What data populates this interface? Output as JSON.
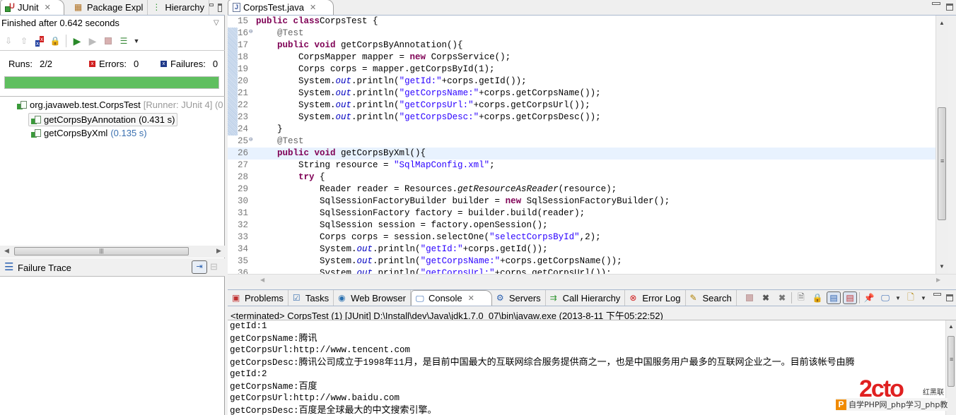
{
  "left_panel": {
    "tabs": [
      {
        "label": "JUnit",
        "active": true,
        "icon": "junit-icon"
      },
      {
        "label": "Package Expl",
        "active": false,
        "icon": "package-explorer-icon"
      },
      {
        "label": "Hierarchy",
        "active": false,
        "icon": "hierarchy-icon"
      }
    ],
    "status": "Finished after 0.642 seconds",
    "runs_label": "Runs:",
    "runs_value": "2/2",
    "errors_label": "Errors:",
    "errors_value": "0",
    "failures_label": "Failures:",
    "failures_value": "0",
    "progress": 1.0,
    "progress_color": "#5fbf5f",
    "tree": {
      "suite_name": "org.javaweb.test.CorpsTest",
      "suite_meta": "[Runner: JUnit 4] (0",
      "tests": [
        {
          "name": "getCorpsByAnnotation",
          "time": "(0.431 s)",
          "selected": true
        },
        {
          "name": "getCorpsByXml",
          "time": "(0.135 s)",
          "selected": false
        }
      ]
    },
    "failure_trace_label": "Failure Trace"
  },
  "editor": {
    "tab_label": "CorpsTest.java",
    "lines": [
      {
        "n": "15",
        "parts": [
          [
            "kw",
            "public class"
          ],
          [
            "",
            "CorpsTest {"
          ]
        ]
      },
      {
        "n": "16",
        "fold": true,
        "parts": [
          [
            "",
            "    "
          ],
          [
            "ann",
            "@Test"
          ]
        ]
      },
      {
        "n": "17",
        "parts": [
          [
            "",
            "    "
          ],
          [
            "kw",
            "public void"
          ],
          [
            "",
            " getCorpsByAnnotation(){"
          ]
        ]
      },
      {
        "n": "18",
        "parts": [
          [
            "",
            "        CorpsMapper mapper = "
          ],
          [
            "kw",
            "new"
          ],
          [
            "",
            " CorpsService();"
          ]
        ]
      },
      {
        "n": "19",
        "parts": [
          [
            "",
            "        Corps corps = mapper.getCorpsById(1);"
          ]
        ]
      },
      {
        "n": "20",
        "parts": [
          [
            "",
            "        System."
          ],
          [
            "fld",
            "out"
          ],
          [
            "",
            ".println("
          ],
          [
            "str",
            "\"getId:\""
          ],
          [
            "",
            "+corps.getId());"
          ]
        ]
      },
      {
        "n": "21",
        "parts": [
          [
            "",
            "        System."
          ],
          [
            "fld",
            "out"
          ],
          [
            "",
            ".println("
          ],
          [
            "str",
            "\"getCorpsName:\""
          ],
          [
            "",
            "+corps.getCorpsName());"
          ]
        ]
      },
      {
        "n": "22",
        "parts": [
          [
            "",
            "        System."
          ],
          [
            "fld",
            "out"
          ],
          [
            "",
            ".println("
          ],
          [
            "str",
            "\"getCorpsUrl:\""
          ],
          [
            "",
            "+corps.getCorpsUrl());"
          ]
        ]
      },
      {
        "n": "23",
        "parts": [
          [
            "",
            "        System."
          ],
          [
            "fld",
            "out"
          ],
          [
            "",
            ".println("
          ],
          [
            "str",
            "\"getCorpsDesc:\""
          ],
          [
            "",
            "+corps.getCorpsDesc());"
          ]
        ]
      },
      {
        "n": "24",
        "parts": [
          [
            "",
            "    }"
          ]
        ]
      },
      {
        "n": "25",
        "fold": true,
        "parts": [
          [
            "",
            "    "
          ],
          [
            "ann",
            "@Test"
          ]
        ]
      },
      {
        "n": "26",
        "highlight": true,
        "parts": [
          [
            "",
            "    "
          ],
          [
            "kw",
            "public void"
          ],
          [
            "",
            " getCorpsByXml(){"
          ]
        ]
      },
      {
        "n": "27",
        "parts": [
          [
            "",
            "        String resource = "
          ],
          [
            "str",
            "\"SqlMapConfig.xml\""
          ],
          [
            "",
            ";"
          ]
        ]
      },
      {
        "n": "28",
        "parts": [
          [
            "",
            "        "
          ],
          [
            "kw",
            "try"
          ],
          [
            "",
            " {"
          ]
        ]
      },
      {
        "n": "29",
        "parts": [
          [
            "",
            "            Reader reader = Resources."
          ],
          [
            "it",
            "getResourceAsReader"
          ],
          [
            "",
            "(resource);"
          ]
        ]
      },
      {
        "n": "30",
        "parts": [
          [
            "",
            "            SqlSessionFactoryBuilder builder = "
          ],
          [
            "kw",
            "new"
          ],
          [
            "",
            " SqlSessionFactoryBuilder();"
          ]
        ]
      },
      {
        "n": "31",
        "parts": [
          [
            "",
            "            SqlSessionFactory factory = builder.build(reader);"
          ]
        ]
      },
      {
        "n": "32",
        "parts": [
          [
            "",
            "            SqlSession session = factory.openSession();"
          ]
        ]
      },
      {
        "n": "33",
        "parts": [
          [
            "",
            "            Corps corps = session.selectOne("
          ],
          [
            "str",
            "\"selectCorpsById\""
          ],
          [
            "",
            ",2);"
          ]
        ]
      },
      {
        "n": "34",
        "parts": [
          [
            "",
            "            System."
          ],
          [
            "fld",
            "out"
          ],
          [
            "",
            ".println("
          ],
          [
            "str",
            "\"getId:\""
          ],
          [
            "",
            "+corps.getId());"
          ]
        ]
      },
      {
        "n": "35",
        "parts": [
          [
            "",
            "            System."
          ],
          [
            "fld",
            "out"
          ],
          [
            "",
            ".println("
          ],
          [
            "str",
            "\"getCorpsName:\""
          ],
          [
            "",
            "+corps.getCorpsName());"
          ]
        ]
      },
      {
        "n": "36",
        "parts": [
          [
            "",
            "            System."
          ],
          [
            "fld",
            "out"
          ],
          [
            "",
            ".println("
          ],
          [
            "str",
            "\"getCorpsUrl:\""
          ],
          [
            "",
            "+corps.getCorpsUrl());"
          ]
        ]
      }
    ]
  },
  "bottom_panel": {
    "tabs": [
      {
        "label": "Problems",
        "icon": "problems-icon"
      },
      {
        "label": "Tasks",
        "icon": "tasks-icon"
      },
      {
        "label": "Web Browser",
        "icon": "globe-icon"
      },
      {
        "label": "Console",
        "icon": "console-icon",
        "active": true
      },
      {
        "label": "Servers",
        "icon": "servers-icon"
      },
      {
        "label": "Call Hierarchy",
        "icon": "call-hierarchy-icon"
      },
      {
        "label": "Error Log",
        "icon": "error-log-icon"
      },
      {
        "label": "Search",
        "icon": "search-icon"
      }
    ],
    "console_header": "<terminated> CorpsTest (1) [JUnit] D:\\Install\\dev\\Java\\jdk1.7.0_07\\bin\\javaw.exe (2013-8-11 下午05:22:52)",
    "console_lines": [
      "getId:1",
      "getCorpsName:腾讯",
      "getCorpsUrl:http://www.tencent.com",
      "getCorpsDesc:腾讯公司成立于1998年11月，是目前中国最大的互联网综合服务提供商之一，也是中国服务用户最多的互联网企业之一。目前该帐号由腾",
      "getId:2",
      "getCorpsName:百度",
      "getCorpsUrl:http://www.baidu.com",
      "getCorpsDesc:百度是全球最大的中文搜索引擎。"
    ]
  },
  "watermark": {
    "logo_text": "2cto",
    "brand": "红黑联盟",
    "caption": "自学PHP网_php学习_php教"
  }
}
